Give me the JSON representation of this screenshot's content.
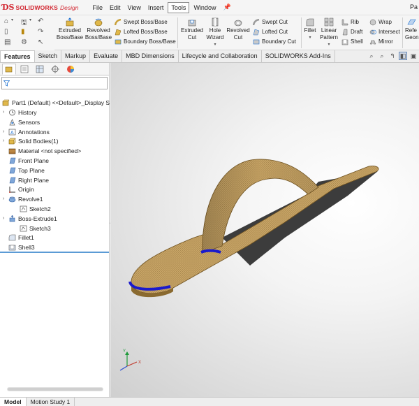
{
  "app": {
    "brand": "SOLIDWORKS",
    "brand_suffix": "Design",
    "title_fragment": "Pa"
  },
  "menu": [
    "File",
    "Edit",
    "View",
    "Insert",
    "Tools",
    "Window"
  ],
  "active_menu": "Tools",
  "ribbon": {
    "extruded_boss": [
      "Extruded",
      "Boss/Base"
    ],
    "revolved_boss": [
      "Revolved",
      "Boss/Base"
    ],
    "swept_boss": "Swept Boss/Base",
    "lofted_boss": "Lofted Boss/Base",
    "boundary_boss": "Boundary Boss/Base",
    "extruded_cut": [
      "Extruded",
      "Cut"
    ],
    "hole_wizard": [
      "Hole",
      "Wizard"
    ],
    "revolved_cut": [
      "Revolved",
      "Cut"
    ],
    "swept_cut": "Swept Cut",
    "lofted_cut": "Lofted Cut",
    "boundary_cut": "Boundary Cut",
    "fillet": "Fillet",
    "linear_pattern": [
      "Linear",
      "Pattern"
    ],
    "rib": "Rib",
    "draft": "Draft",
    "shell": "Shell",
    "wrap": "Wrap",
    "intersect": "Intersect",
    "mirror": "Mirror",
    "reference_geometry": [
      "Refe",
      "Geon"
    ]
  },
  "command_tabs": [
    "Features",
    "Sketch",
    "Markup",
    "Evaluate",
    "MBD Dimensions",
    "Lifecycle and Collaboration",
    "SOLIDWORKS Add-Ins"
  ],
  "active_command_tab": "Features",
  "feature_tree": {
    "root": "Part1 (Default) <<Default>_Display S",
    "items": [
      {
        "label": "History",
        "icon": "history-icon",
        "expandable": true,
        "indent": 0
      },
      {
        "label": "Sensors",
        "icon": "sensors-icon",
        "expandable": false,
        "indent": 0
      },
      {
        "label": "Annotations",
        "icon": "annotations-icon",
        "expandable": true,
        "indent": 0
      },
      {
        "label": "Solid Bodies(1)",
        "icon": "solid-bodies-icon",
        "expandable": true,
        "indent": 0
      },
      {
        "label": "Material <not specified>",
        "icon": "material-icon",
        "expandable": false,
        "indent": 0
      },
      {
        "label": "Front Plane",
        "icon": "plane-icon",
        "expandable": false,
        "indent": 0
      },
      {
        "label": "Top Plane",
        "icon": "plane-icon",
        "expandable": false,
        "indent": 0
      },
      {
        "label": "Right Plane",
        "icon": "plane-icon",
        "expandable": false,
        "indent": 0
      },
      {
        "label": "Origin",
        "icon": "origin-icon",
        "expandable": false,
        "indent": 0
      },
      {
        "label": "Revolve1",
        "icon": "revolve-icon",
        "expandable": true,
        "indent": 0
      },
      {
        "label": "Sketch2",
        "icon": "sketch-icon",
        "expandable": false,
        "indent": 1
      },
      {
        "label": "Boss-Extrude1",
        "icon": "extrude-icon",
        "expandable": true,
        "indent": 0
      },
      {
        "label": "Sketch3",
        "icon": "sketch-icon",
        "expandable": false,
        "indent": 1
      },
      {
        "label": "Fillet1",
        "icon": "fillet-icon",
        "expandable": false,
        "indent": 0
      },
      {
        "label": "Shell3",
        "icon": "shell-icon",
        "expandable": false,
        "indent": 0
      }
    ]
  },
  "bottom_tabs": [
    "Model",
    "Motion Study 1"
  ],
  "active_bottom_tab": "Model",
  "colors": {
    "accent_red": "#d22630",
    "model_tan": "#c8a86a",
    "edge_blue": "#1a1acc",
    "selection_blue": "#5b9bd5"
  }
}
